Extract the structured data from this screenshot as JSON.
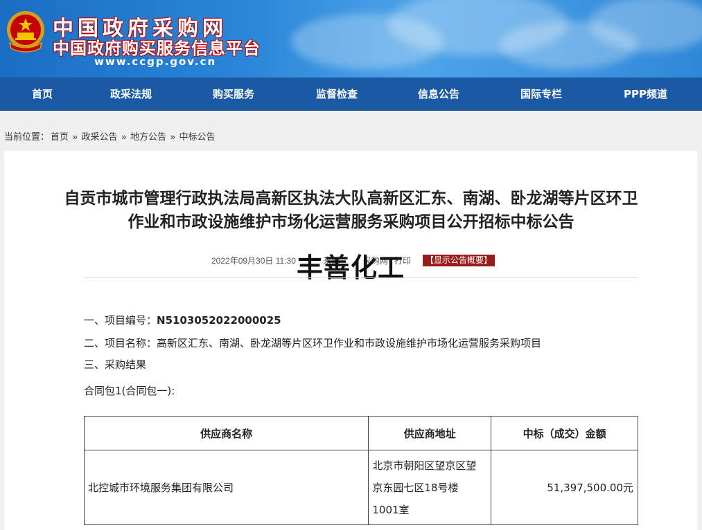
{
  "header": {
    "site_title": "中国政府采购网",
    "site_subtitle": "中国政府购买服务信息平台",
    "site_url": "www.ccgp.gov.cn"
  },
  "nav": {
    "items": [
      "首页",
      "政采法规",
      "购买服务",
      "监督检查",
      "信息公告",
      "国际专栏",
      "PPP频道"
    ]
  },
  "breadcrumb": {
    "prefix": "当前位置：",
    "items": [
      "首页",
      "政采公告",
      "地方公告",
      "中标公告"
    ],
    "separator": "»"
  },
  "article": {
    "title_line1": "自贡市城市管理行政执法局高新区执法大队高新区汇东、南湖、卧龙湖等片区环卫",
    "title_line2": "作业和市政设施维护市场化运营服务采购项目公开招标中标公告",
    "meta_text": "2022年09月30日 11:30",
    "meta_partial_1": "来源",
    "meta_partial_2": "采购网",
    "meta_print": "打印",
    "summary_button": "【显示公告概要】",
    "watermark": "丰善化工",
    "item1_label": "一、项目编号：",
    "item1_value": "N5103052022000025",
    "item2_label": "二、项目名称：",
    "item2_value": "高新区汇东、南湖、卧龙湖等片区环卫作业和市政设施维护市场化运营服务采购项目",
    "item3_label": "三、采购结果",
    "package_label": "合同包1(合同包一):"
  },
  "result_table": {
    "headers": [
      "供应商名称",
      "供应商地址",
      "中标（成交）金额"
    ],
    "rows": [
      {
        "supplier": "北控城市环境服务集团有限公司",
        "address_line1": "北京市朝阳区望京区望",
        "address_line2": "京东园七区18号楼",
        "address_line3": "1001室",
        "amount": "51,397,500.00元"
      }
    ]
  },
  "colors": {
    "header_blue": "#1a6ec4",
    "nav_blue": "#1a5aa4",
    "logo_red": "#c40000",
    "summary_button_red": "#9b1c1c"
  }
}
